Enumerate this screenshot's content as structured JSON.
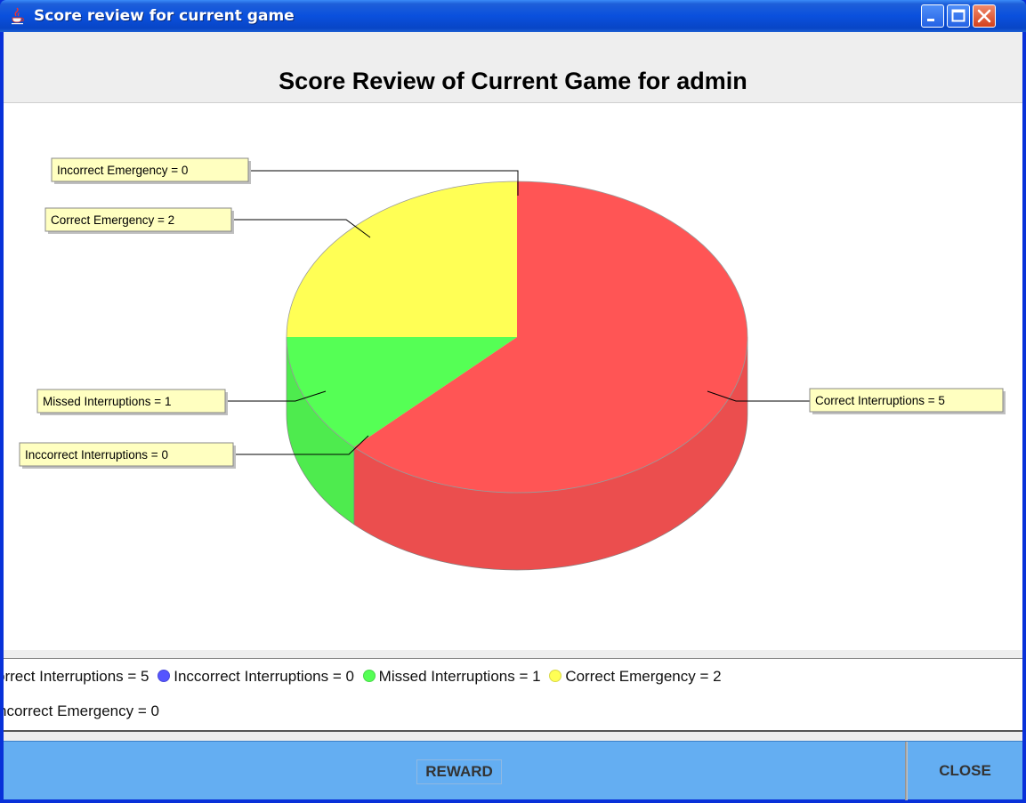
{
  "window": {
    "title": "Score review for current game",
    "icon": "java-cup-icon",
    "controls": [
      "minimize",
      "maximize",
      "close"
    ]
  },
  "header": {
    "title": "Score Review of Current Game for admin"
  },
  "chart_data": {
    "type": "pie",
    "style": "3d",
    "title": "",
    "slices": [
      {
        "label": "Correct Interruptions",
        "value": 5,
        "callout": "Correct Interruptions = 5",
        "legend": "orrect Interruptions = 5",
        "color": "#ff5555"
      },
      {
        "label": "Inccorrect Interruptions",
        "value": 0,
        "callout": "Inccorrect Interruptions = 0",
        "legend": "Inccorrect Interruptions = 0",
        "color": "#5555ff"
      },
      {
        "label": "Missed Interruptions",
        "value": 1,
        "callout": "Missed Interruptions = 1",
        "legend": "Missed Interruptions = 1",
        "color": "#55ff55"
      },
      {
        "label": "Correct Emergency",
        "value": 2,
        "callout": "Correct Emergency = 2",
        "legend": "Correct Emergency = 2",
        "color": "#ffff55"
      },
      {
        "label": "Incorrect Emergency",
        "value": 0,
        "callout": "Incorrect Emergency = 0",
        "legend": "ncorrect Emergency = 0",
        "color": "#ff55ff"
      }
    ],
    "legend_placement": "bottom"
  },
  "buttons": {
    "reward": "REWARD",
    "close": "CLOSE"
  }
}
